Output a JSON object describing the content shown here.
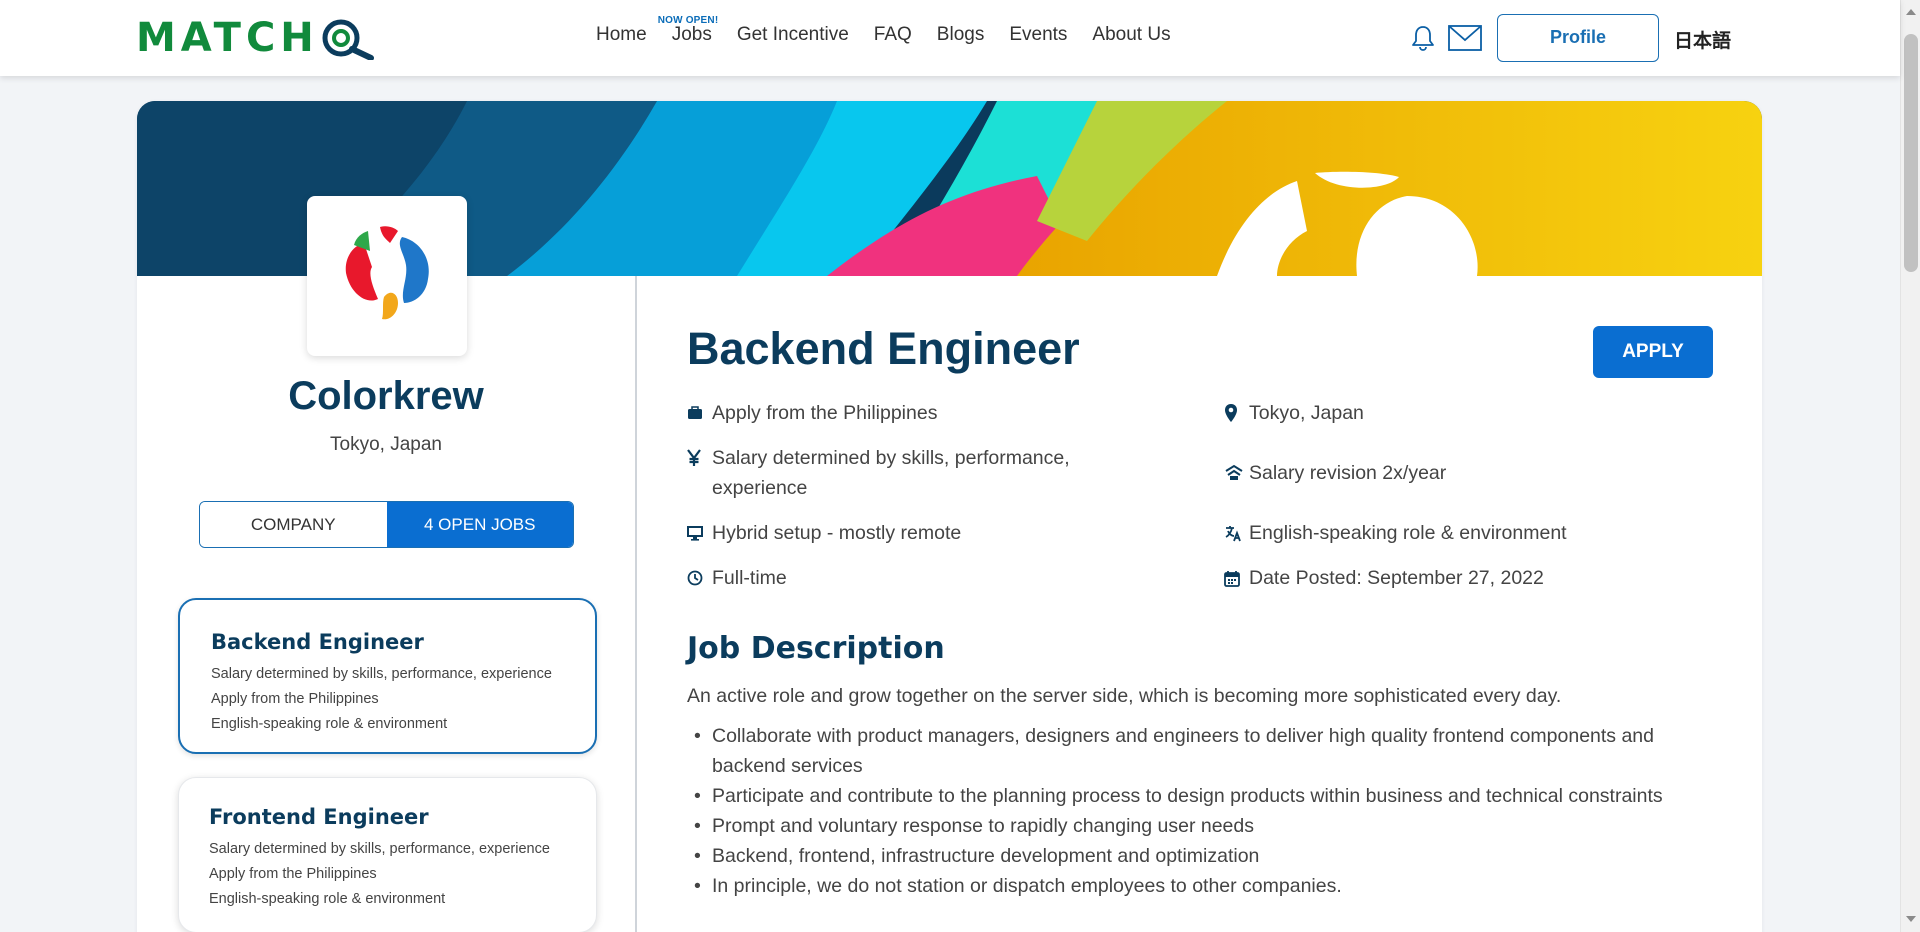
{
  "header": {
    "logo_text": "MATCH",
    "nav": [
      {
        "label": "Home"
      },
      {
        "label": "Jobs",
        "badge": "NOW OPEN!"
      },
      {
        "label": "Get Incentive"
      },
      {
        "label": "FAQ"
      },
      {
        "label": "Blogs"
      },
      {
        "label": "Events"
      },
      {
        "label": "About Us"
      }
    ],
    "profile_label": "Profile",
    "language_label": "日本語"
  },
  "company": {
    "name": "Colorkrew",
    "location": "Tokyo, Japan",
    "tab_company": "COMPANY",
    "tab_jobs": "4 OPEN JOBS"
  },
  "job_cards": [
    {
      "title": "Backend Engineer",
      "lines": [
        "Salary determined by skills, performance, experience",
        "Apply from the Philippines",
        "English-speaking role & environment"
      ]
    },
    {
      "title": "Frontend Engineer",
      "lines": [
        "Salary determined by skills, performance, experience",
        "Apply from the Philippines",
        "English-speaking role & environment"
      ]
    }
  ],
  "job": {
    "title": "Backend Engineer",
    "apply_label": "APPLY",
    "info": {
      "apply_from": "Apply from the Philippines",
      "location": "Tokyo, Japan",
      "salary": "Salary determined by skills, performance, experience",
      "salary_revision": "Salary revision 2x/year",
      "setup": "Hybrid setup - mostly remote",
      "language": "English-speaking role & environment",
      "type": "Full-time",
      "date_posted": "Date Posted: September 27, 2022"
    },
    "description_title": "Job Description",
    "description_intro": "An active role and grow together on the server side, which is becoming more sophisticated every day.",
    "description_items": [
      "Collaborate with product managers, designers and engineers to deliver high quality frontend components and backend services",
      "Participate and contribute to the planning process to design products within business and technical constraints",
      "Prompt and voluntary response to rapidly changing user needs",
      "Backend, frontend, infrastructure development and optimization",
      "In principle, we do not station or dispatch employees to other companies."
    ]
  },
  "colors": {
    "brand_green": "#118a3c",
    "primary_blue": "#0a6ed1",
    "heading_navy": "#0b3c5d"
  }
}
